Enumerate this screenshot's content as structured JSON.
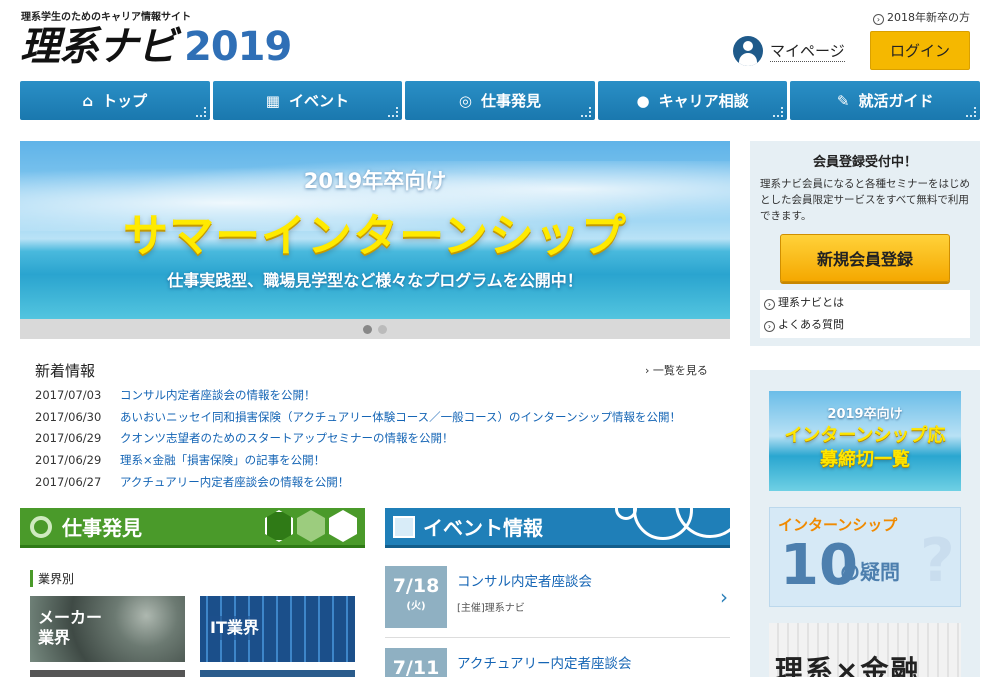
{
  "header": {
    "tagline": "理系学生のためのキャリア情報サイト",
    "logo_jp": "理系ナビ",
    "logo_year": "2019",
    "newgrad_link": "2018年新卒の方",
    "mypage": "マイページ",
    "login": "ログイン"
  },
  "nav": [
    {
      "label": "トップ",
      "icon": "home-icon"
    },
    {
      "label": "イベント",
      "icon": "calendar-icon"
    },
    {
      "label": "仕事発見",
      "icon": "search-icon"
    },
    {
      "label": "キャリア相談",
      "icon": "chat-bubble-icon"
    },
    {
      "label": "就活ガイド",
      "icon": "pencil-icon"
    }
  ],
  "banner": {
    "year": "2019年卒向け",
    "title": "サマーインターンシップ",
    "subtitle": "仕事実践型、職場見学型など様々なプログラムを公開中！"
  },
  "news": {
    "heading": "新着情報",
    "more": "一覧を見る",
    "items": [
      {
        "date": "2017/07/03",
        "text": "コンサル内定者座談会の情報を公開！"
      },
      {
        "date": "2017/06/30",
        "text": "あいおいニッセイ同和損害保険（アクチュアリー体験コース／一般コース）のインターンシップ情報を公開！"
      },
      {
        "date": "2017/06/29",
        "text": "クオンツ志望者のためのスタートアップセミナーの情報を公開！"
      },
      {
        "date": "2017/06/29",
        "text": "理系×金融「損害保険」の記事を公開！"
      },
      {
        "date": "2017/06/27",
        "text": "アクチュアリー内定者座談会の情報を公開！"
      }
    ]
  },
  "job": {
    "heading": "仕事発見",
    "industry_label": "業界別",
    "tiles": [
      "メーカー業界",
      "IT業界"
    ]
  },
  "events": {
    "heading": "イベント情報",
    "items": [
      {
        "date": "7/18",
        "weekday": "(火)",
        "title": "コンサル内定者座談会",
        "host": "[主催]理系ナビ"
      },
      {
        "date": "7/11",
        "weekday": "",
        "title": "アクチュアリー内定者座談会",
        "host": ""
      }
    ]
  },
  "member": {
    "title": "会員登録受付中！",
    "desc": "理系ナビ会員になると各種セミナーをはじめとした会員限定サービスをすべて無料で利用できます。",
    "register": "新規会員登録",
    "links": [
      "理系ナビとは",
      "よくある質問"
    ]
  },
  "side_banners": {
    "b1_year": "2019卒向け",
    "b1_title": "インターンシップ応募締切一覧",
    "b2_top": "インターンシップ",
    "b2_num": "10",
    "b2_text": "の疑問",
    "b3_text": "理系×金融"
  },
  "colors": {
    "nav_blue": "#1a78ae",
    "logo_blue": "#2f6fb6",
    "login_yellow": "#f5b800",
    "job_green": "#4a9a2a",
    "link_blue": "#1565b5"
  }
}
